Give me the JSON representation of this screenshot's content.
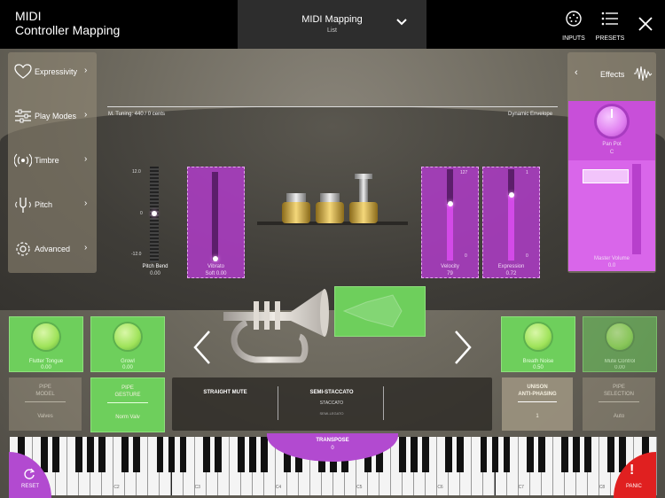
{
  "header": {
    "app_title_line1": "MIDI",
    "app_title_line2": "Controller Mapping",
    "mapping_title": "MIDI Mapping",
    "mapping_subtitle": "List",
    "inputs_label": "INPUTS",
    "presets_label": "PRESETS"
  },
  "left_menu": {
    "items": [
      {
        "label": "Expressivity",
        "icon": "heart-icon"
      },
      {
        "label": "Play Modes",
        "icon": "sliders-icon"
      },
      {
        "label": "Timbre",
        "icon": "radio-waves-icon"
      },
      {
        "label": "Pitch",
        "icon": "tuning-fork-icon"
      },
      {
        "label": "Advanced",
        "icon": "gear-icon"
      }
    ]
  },
  "effects_panel": {
    "title": "Effects",
    "back_label": "‹",
    "panpot_label": "Pan Pot",
    "panpot_value": "C",
    "master_volume_label": "Master Volume",
    "master_volume_value": "0.0"
  },
  "tuning": {
    "text": "M. Tuning: 440   / 0 cents",
    "dynamic_envelope": "Dynamic Envelope"
  },
  "controls": {
    "pitch_bend": {
      "label": "Pitch Bend",
      "value": "0.00",
      "max": "12.0",
      "min": "-12.0",
      "zero": "0"
    },
    "vibrato": {
      "label": "Vibrato",
      "value": "Soft 0.00"
    },
    "velocity": {
      "label": "Velocity",
      "value": "79",
      "max": "127",
      "min": "0",
      "level": 0.62
    },
    "expression": {
      "label": "Expression",
      "value": "0.72",
      "max": "1",
      "min": "0",
      "level": 0.72
    }
  },
  "green_tiles": {
    "flutter_tongue": {
      "label": "Flutter Tongue",
      "value": "0.00"
    },
    "growl": {
      "label": "Growl",
      "value": "0.00"
    },
    "breath_noise": {
      "label": "Breath Noise",
      "value": "0.50"
    },
    "mute_control": {
      "label": "Mute Control",
      "value": "0.00"
    }
  },
  "selectors": {
    "pipe_model": {
      "title_line1": "PIPE",
      "title_line2": "MODEL",
      "value": "Valves"
    },
    "pipe_gesture": {
      "title_line1": "PIPE",
      "title_line2": "GESTURE",
      "value": "Norm Valv"
    },
    "unison": {
      "title_line1": "UNISON",
      "title_line2": "ANTI-PHASING",
      "value": "1"
    },
    "pipe_selection": {
      "title_line1": "PIPE",
      "title_line2": "SELECTION",
      "value": "Auto"
    }
  },
  "mutes": {
    "straight": "STRAIGHT MUTE",
    "articulation": "SEMI-STACCATO",
    "articulation_prev": "STACCATO",
    "articulation_next": "SEMI-LEGATO"
  },
  "keyboard": {
    "transpose_label": "TRANSPOSE",
    "transpose_value": "0",
    "reset_label": "RESET",
    "panic_label": "PANIC",
    "octaves": [
      "C1",
      "C2",
      "C3",
      "C4",
      "C5",
      "C6",
      "C7",
      "C8"
    ]
  },
  "colors": {
    "accent_purple": "#b24ad0",
    "accent_green": "#6ecf5c",
    "panic_red": "#e02020"
  }
}
